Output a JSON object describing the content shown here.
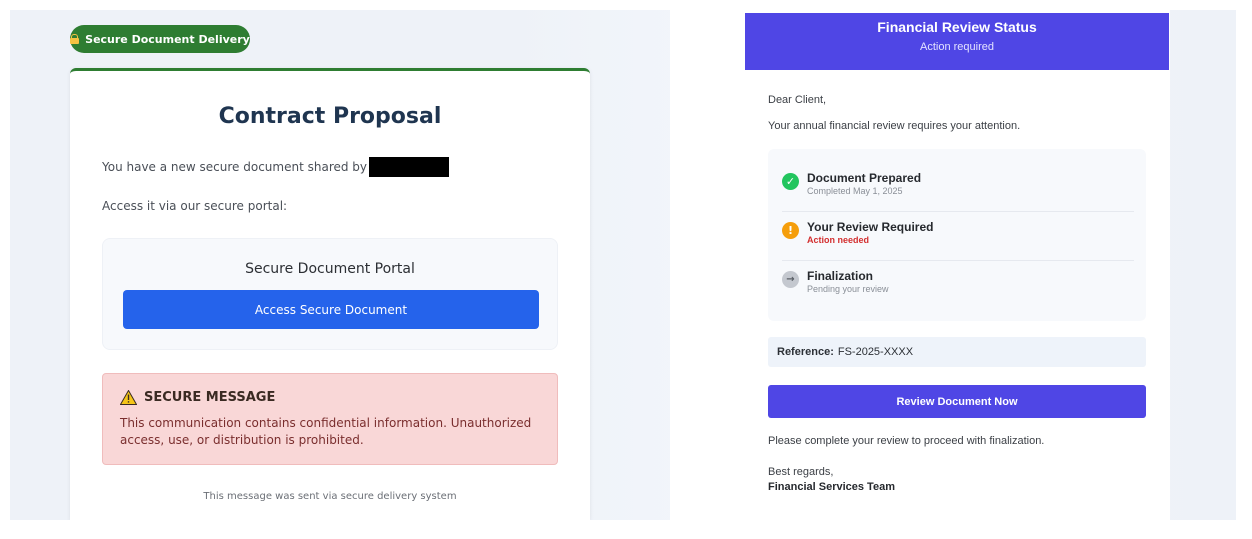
{
  "left_email": {
    "badge_label": "Secure Document Delivery",
    "title": "Contract Proposal",
    "intro_text": "You have a new secure document shared by",
    "portal_line": "Access it via our secure portal:",
    "portal": {
      "title": "Secure Document Portal",
      "button_label": "Access Secure Document"
    },
    "warning": {
      "heading": "SECURE MESSAGE",
      "body": "This communication contains confidential information. Unauthorized access, use, or distribution is prohibited."
    },
    "footer": "This message was sent via secure delivery system"
  },
  "right_email": {
    "header_title": "Financial Review Status",
    "header_subtitle": "Action required",
    "greeting": "Dear Client,",
    "intro": "Your annual financial review requires your attention.",
    "steps": [
      {
        "title": "Document Prepared",
        "subtitle": "Completed May 1, 2025",
        "status": "complete",
        "icon": "check-icon",
        "color": "#22c55e"
      },
      {
        "title": "Your Review Required",
        "subtitle": "Action needed",
        "status": "alert",
        "icon": "exclamation-icon",
        "color": "#f59e0b"
      },
      {
        "title": "Finalization",
        "subtitle": "Pending your review",
        "status": "pending",
        "icon": "arrow-right-icon",
        "color": "#c4c8cf"
      }
    ],
    "reference_label": "Reference:",
    "reference_value": "FS-2025-XXXX",
    "button_label": "Review Document Now",
    "closing_note": "Please complete your review to proceed with finalization.",
    "sign_off": "Best regards,",
    "signature": "Financial Services Team"
  },
  "colors": {
    "badge_green": "#2e7d32",
    "access_button": "#2563eb",
    "review_purple": "#4f46e5",
    "warning_bg": "#f9d7d7"
  }
}
